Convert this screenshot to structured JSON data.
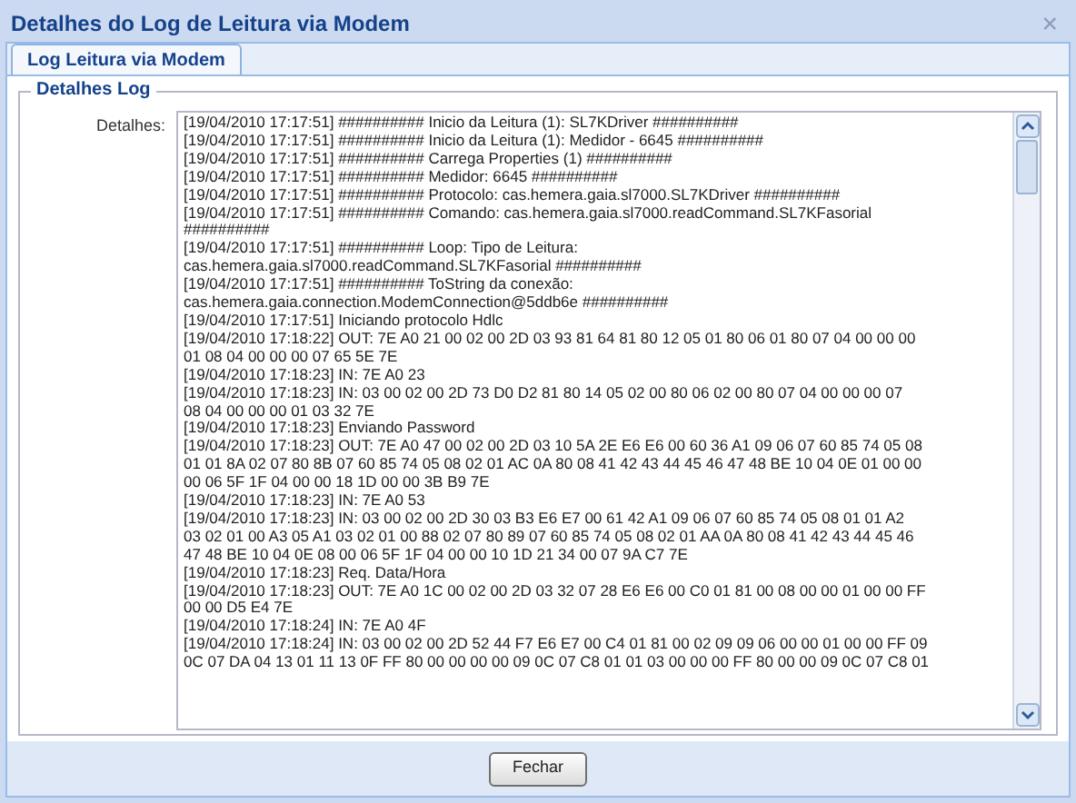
{
  "window": {
    "title": "Detalhes do Log de Leitura via Modem",
    "close": "×"
  },
  "tabs": [
    {
      "label": "Log Leitura via Modem",
      "selected": true
    }
  ],
  "fieldset": {
    "legend": "Detalhes Log",
    "label": "Detalhes:"
  },
  "log_lines": [
    "[19/04/2010 17:17:51] ########## Inicio da Leitura (1): SL7KDriver ##########",
    "[19/04/2010 17:17:51] ########## Inicio da Leitura (1): Medidor - 6645 ##########",
    "[19/04/2010 17:17:51] ########## Carrega Properties (1) ##########",
    "[19/04/2010 17:17:51] ########## Medidor: 6645 ##########",
    "[19/04/2010 17:17:51] ########## Protocolo: cas.hemera.gaia.sl7000.SL7KDriver ##########",
    "[19/04/2010 17:17:51] ########## Comando: cas.hemera.gaia.sl7000.readCommand.SL7KFasorial",
    "##########",
    "[19/04/2010 17:17:51] ########## Loop: Tipo de Leitura:",
    "cas.hemera.gaia.sl7000.readCommand.SL7KFasorial ##########",
    "[19/04/2010 17:17:51] ########## ToString da conexão:",
    "cas.hemera.gaia.connection.ModemConnection@5ddb6e ##########",
    "[19/04/2010 17:17:51] Iniciando protocolo Hdlc",
    "[19/04/2010 17:18:22] OUT: 7E A0 21 00 02 00 2D 03 93 81 64 81 80 12 05 01 80 06 01 80 07 04 00 00 00",
    "01 08 04 00 00 00 07 65 5E 7E",
    "[19/04/2010 17:18:23] IN: 7E A0 23",
    "[19/04/2010 17:18:23] IN: 03 00 02 00 2D 73 D0 D2 81 80 14 05 02 00 80 06 02 00 80 07 04 00 00 00 07",
    "08 04 00 00 00 01 03 32 7E",
    "[19/04/2010 17:18:23] Enviando Password",
    "[19/04/2010 17:18:23] OUT: 7E A0 47 00 02 00 2D 03 10 5A 2E E6 E6 00 60 36 A1 09 06 07 60 85 74 05 08",
    "01 01 8A 02 07 80 8B 07 60 85 74 05 08 02 01 AC 0A 80 08 41 42 43 44 45 46 47 48 BE 10 04 0E 01 00 00",
    "00 06 5F 1F 04 00 00 18 1D 00 00 3B B9 7E",
    "[19/04/2010 17:18:23] IN: 7E A0 53",
    "[19/04/2010 17:18:23] IN: 03 00 02 00 2D 30 03 B3 E6 E7 00 61 42 A1 09 06 07 60 85 74 05 08 01 01 A2",
    "03 02 01 00 A3 05 A1 03 02 01 00 88 02 07 80 89 07 60 85 74 05 08 02 01 AA 0A 80 08 41 42 43 44 45 46",
    "47 48 BE 10 04 0E 08 00 06 5F 1F 04 00 00 10 1D 21 34 00 07 9A C7 7E",
    "[19/04/2010 17:18:23] Req. Data/Hora",
    "[19/04/2010 17:18:23] OUT: 7E A0 1C 00 02 00 2D 03 32 07 28 E6 E6 00 C0 01 81 00 08 00 00 01 00 00 FF",
    "00 00 D5 E4 7E",
    "[19/04/2010 17:18:24] IN: 7E A0 4F",
    "[19/04/2010 17:18:24] IN: 03 00 02 00 2D 52 44 F7 E6 E7 00 C4 01 81 00 02 09 09 06 00 00 01 00 00 FF 09",
    "0C 07 DA 04 13 01 11 13 0F FF 80 00 00 00 00 09 0C 07 C8 01 01 03 00 00 00 FF 80 00 00 09 0C 07 C8 01"
  ],
  "buttons": [
    "Fechar"
  ]
}
